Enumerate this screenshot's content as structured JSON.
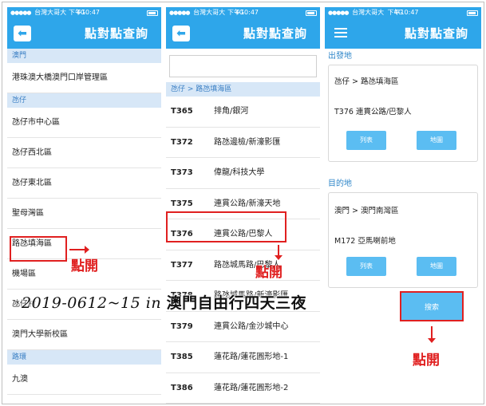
{
  "status_bar": {
    "carrier": "台灣大哥大",
    "network": "4G",
    "time": "下午10:47"
  },
  "screen1": {
    "title": "點對點查詢",
    "back_icon": "back-arrow-icon",
    "sections": [
      {
        "header": "澳門",
        "items": [
          "港珠澳大橋澳門口岸管理區"
        ]
      },
      {
        "header": "氹仔",
        "items": [
          "氹仔市中心區",
          "氹仔西北區",
          "氹仔東北區",
          "聖母灣區",
          "路氹填海區",
          "機場區",
          "氹仔村",
          "澳門大學新校區"
        ]
      },
      {
        "header": "路環",
        "items": [
          "九澳"
        ]
      }
    ],
    "annotation": "點開"
  },
  "screen2": {
    "title": "點對點查詢",
    "back_icon": "back-arrow-icon",
    "search_placeholder": "",
    "breadcrumb": "氹仔 > 路氹填海區",
    "routes": [
      {
        "code": "T365",
        "stop": "排角/銀河"
      },
      {
        "code": "T372",
        "stop": "路氹邊檢/新濠影匯"
      },
      {
        "code": "T373",
        "stop": "偉龍/科技大學"
      },
      {
        "code": "T375",
        "stop": "連貫公路/新濠天地"
      },
      {
        "code": "T376",
        "stop": "連貫公路/巴黎人"
      },
      {
        "code": "T377",
        "stop": "路氹城馬路/巴黎人"
      },
      {
        "code": "T378",
        "stop": "路氹城馬路/新濠影匯"
      },
      {
        "code": "T379",
        "stop": "連貫公路/金沙城中心"
      },
      {
        "code": "T385",
        "stop": "蓮花路/蓮花圓形地-1"
      },
      {
        "code": "T386",
        "stop": "蓮花路/蓮花圓形地-2"
      }
    ],
    "annotation": "點開"
  },
  "screen3": {
    "title": "點對點查詢",
    "menu_icon": "hamburger-menu-icon",
    "origin": {
      "label": "出發地",
      "area": "氹仔 > 路氹填海區",
      "stop": "T376 連貫公路/巴黎人",
      "list_button": "列表",
      "map_button": "地圖"
    },
    "destination": {
      "label": "目的地",
      "area": "澳門 > 澳門南灣區",
      "stop": "M172 亞馬喇前地",
      "list_button": "列表",
      "map_button": "地圖"
    },
    "search_button": "搜索",
    "annotation": "點開"
  },
  "caption": {
    "latin": "2019-0612~15 in ",
    "cjk": "澳門自由行四天三夜"
  },
  "colors": {
    "header_blue": "#2ea6ea",
    "button_blue": "#5bbdf2",
    "section_bg": "#d7e7f7",
    "highlight_red": "#e02020"
  }
}
